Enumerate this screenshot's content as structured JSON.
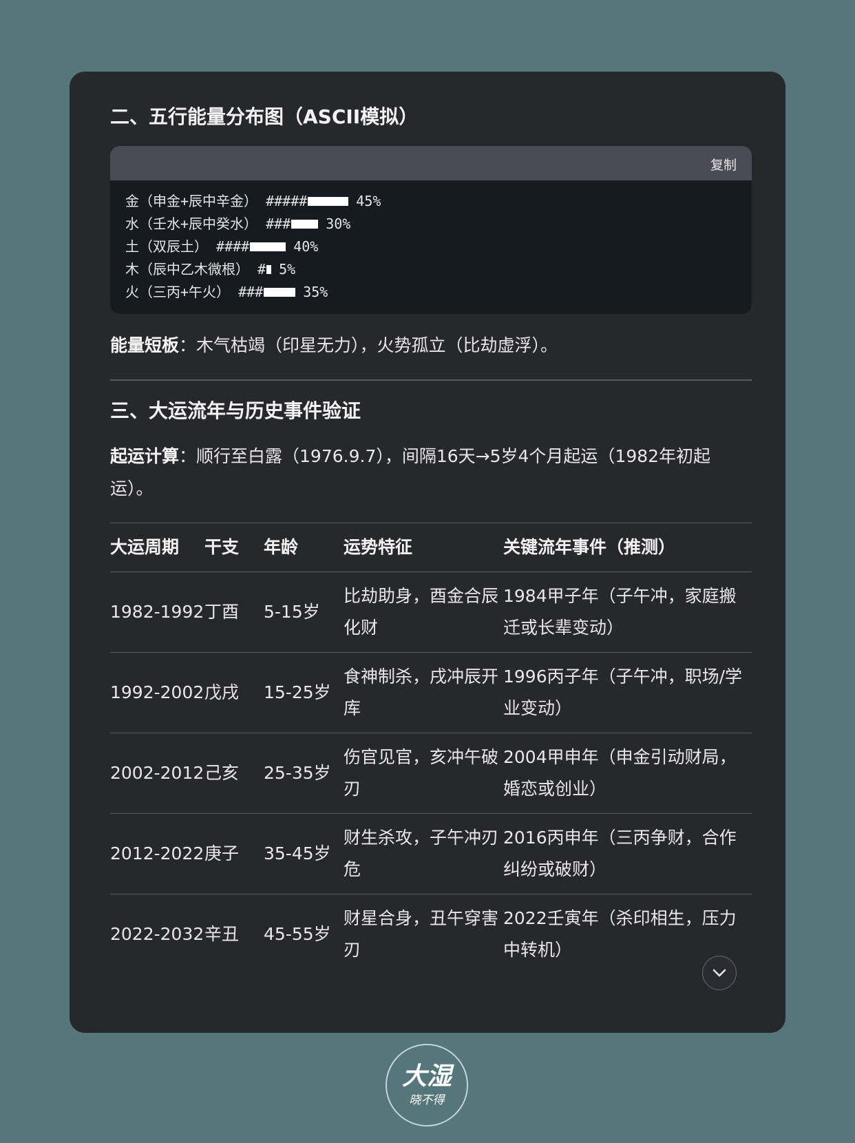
{
  "section2": {
    "title": "二、五行能量分布图（ASCII模拟）",
    "copy_label": "复制",
    "code_lines": [
      {
        "label": "金（申金+辰中辛金） #####",
        "pct": "45%",
        "bar_fraction": 0.45
      },
      {
        "label": "水（壬水+辰中癸水） ###",
        "pct": "30%",
        "bar_fraction": 0.3
      },
      {
        "label": "土（双辰土） ####",
        "pct": "40%",
        "bar_fraction": 0.4
      },
      {
        "label": "木（辰中乙木微根） #",
        "pct": "5%",
        "bar_fraction": 0.05
      },
      {
        "label": "火（三丙+午火） ###",
        "pct": "35%",
        "bar_fraction": 0.35
      }
    ],
    "note_bold": "能量短板",
    "note_text": "：木气枯竭（印星无力），火势孤立（比劫虚浮）。"
  },
  "section3": {
    "title": "三、大运流年与历史事件验证",
    "calc_bold": "起运计算",
    "calc_text": "：顺行至白露（1976.9.7），间隔16天→5岁4个月起运（1982年初起运）。",
    "table": {
      "headers": [
        "大运周期",
        "干支",
        "年龄",
        "运势特征",
        "关键流年事件（推测）"
      ],
      "rows": [
        [
          "1982-1992",
          "丁酉",
          "5-15岁",
          "比劫助身，酉金合辰化财",
          "1984甲子年（子午冲，家庭搬迁或长辈变动）"
        ],
        [
          "1992-2002",
          "戊戌",
          "15-25岁",
          "食神制杀，戌冲辰开库",
          "1996丙子年（子午冲，职场/学业变动）"
        ],
        [
          "2002-2012",
          "己亥",
          "25-35岁",
          "伤官见官，亥冲午破刃",
          "2004甲申年（申金引动财局，婚恋或创业）"
        ],
        [
          "2012-2022",
          "庚子",
          "35-45岁",
          "财生杀攻，子午冲刃危",
          "2016丙申年（三丙争财，合作纠纷或破财）"
        ],
        [
          "2022-2032",
          "辛丑",
          "45-55岁",
          "财星合身，丑午穿害刃",
          "2022壬寅年（杀印相生，压力中转机）"
        ]
      ]
    }
  },
  "logo": {
    "main": "大湿",
    "sub": "晓不得"
  },
  "icons": {
    "scroll": "chevron-down-icon"
  }
}
